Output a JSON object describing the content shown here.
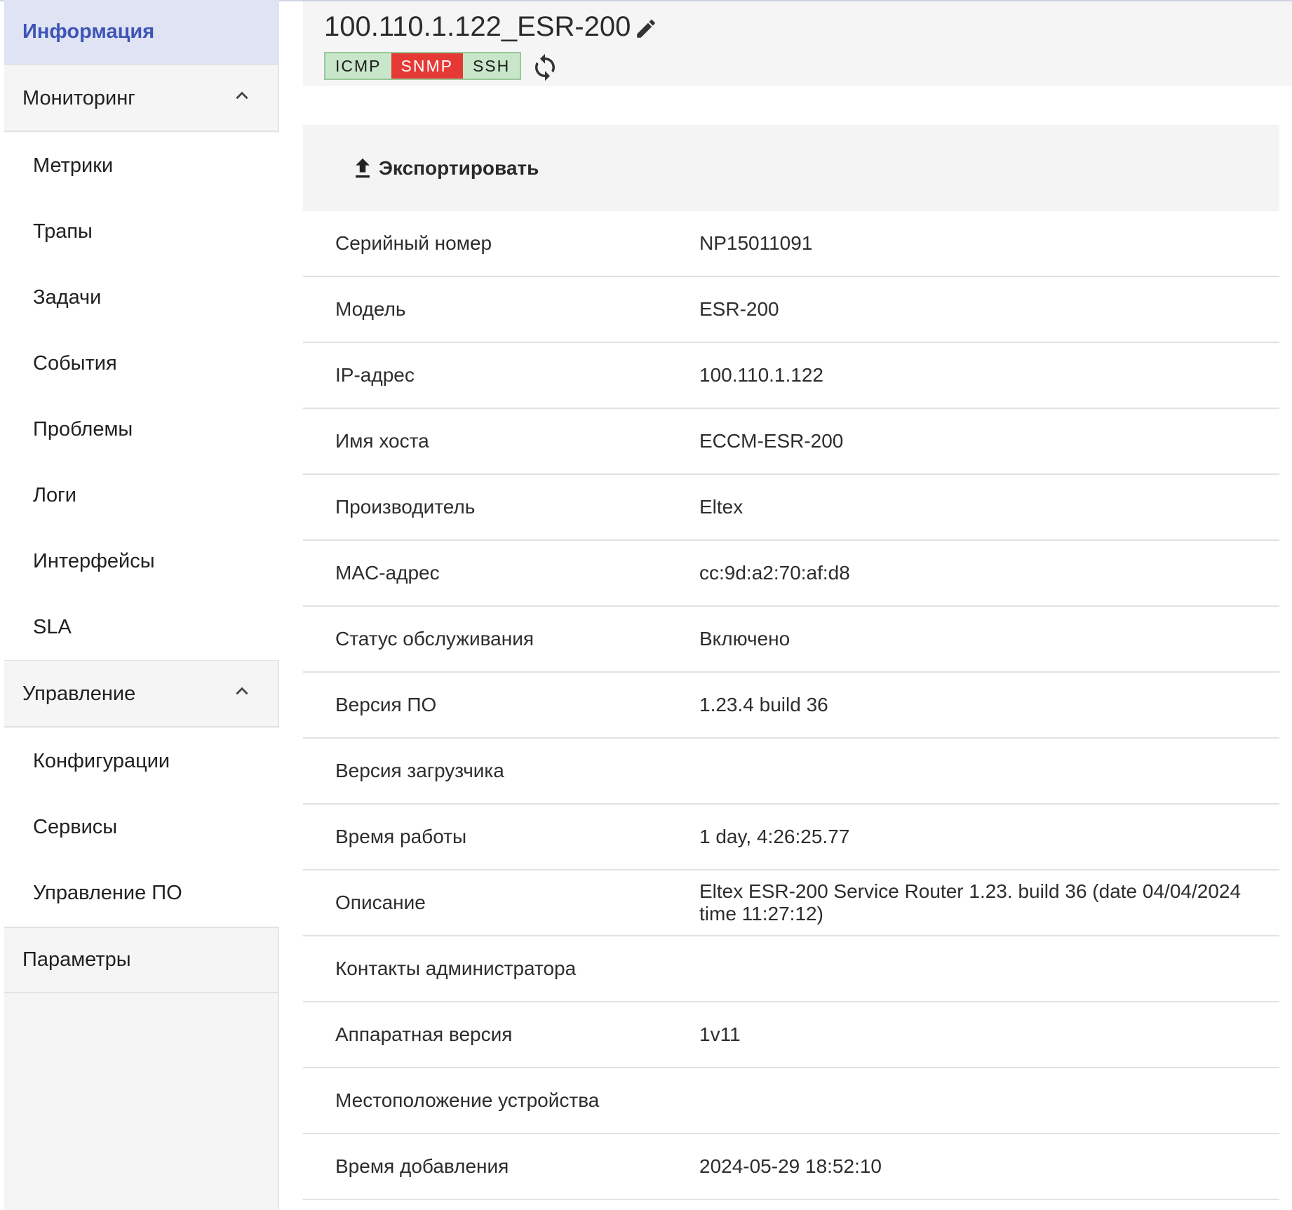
{
  "sidebar": {
    "info": "Информация",
    "monitoring": {
      "label": "Мониторинг",
      "items": [
        "Метрики",
        "Трапы",
        "Задачи",
        "События",
        "Проблемы",
        "Логи",
        "Интерфейсы",
        "SLA"
      ]
    },
    "management": {
      "label": "Управление",
      "items": [
        "Конфигурации",
        "Сервисы",
        "Управление ПО"
      ]
    },
    "parameters": "Параметры"
  },
  "header": {
    "title": "100.110.1.122_ESR-200",
    "badges": [
      {
        "label": "ICMP",
        "status": "ok",
        "color": "#c8e6c9"
      },
      {
        "label": "SNMP",
        "status": "error",
        "color": "#e53935"
      },
      {
        "label": "SSH",
        "status": "ok",
        "color": "#c8e6c9"
      }
    ]
  },
  "toolbar": {
    "export_label": "Экспортировать"
  },
  "details": [
    {
      "label": "Серийный номер",
      "value": "NP15011091"
    },
    {
      "label": "Модель",
      "value": "ESR-200"
    },
    {
      "label": "IP-адрес",
      "value": "100.110.1.122"
    },
    {
      "label": "Имя хоста",
      "value": "ECCM-ESR-200"
    },
    {
      "label": "Производитель",
      "value": "Eltex"
    },
    {
      "label": "MAC-адрес",
      "value": "cc:9d:a2:70:af:d8"
    },
    {
      "label": "Статус обслуживания",
      "value": "Включено"
    },
    {
      "label": "Версия ПО",
      "value": "1.23.4 build 36"
    },
    {
      "label": "Версия загрузчика",
      "value": ""
    },
    {
      "label": "Время работы",
      "value": "1 day, 4:26:25.77"
    },
    {
      "label": "Описание",
      "value": "Eltex ESR-200 Service Router 1.23. build 36 (date 04/04/2024 time 11:27:12)"
    },
    {
      "label": "Контакты администратора",
      "value": ""
    },
    {
      "label": "Аппаратная версия",
      "value": "1v11"
    },
    {
      "label": "Местоположение устройства",
      "value": ""
    },
    {
      "label": "Время добавления",
      "value": "2024-05-29 18:52:10"
    }
  ],
  "colors": {
    "accent": "#3d55b5",
    "active_bg": "#dfe3f3",
    "snmp_error": "#e53935",
    "ok_badge": "#c8e6c9"
  }
}
